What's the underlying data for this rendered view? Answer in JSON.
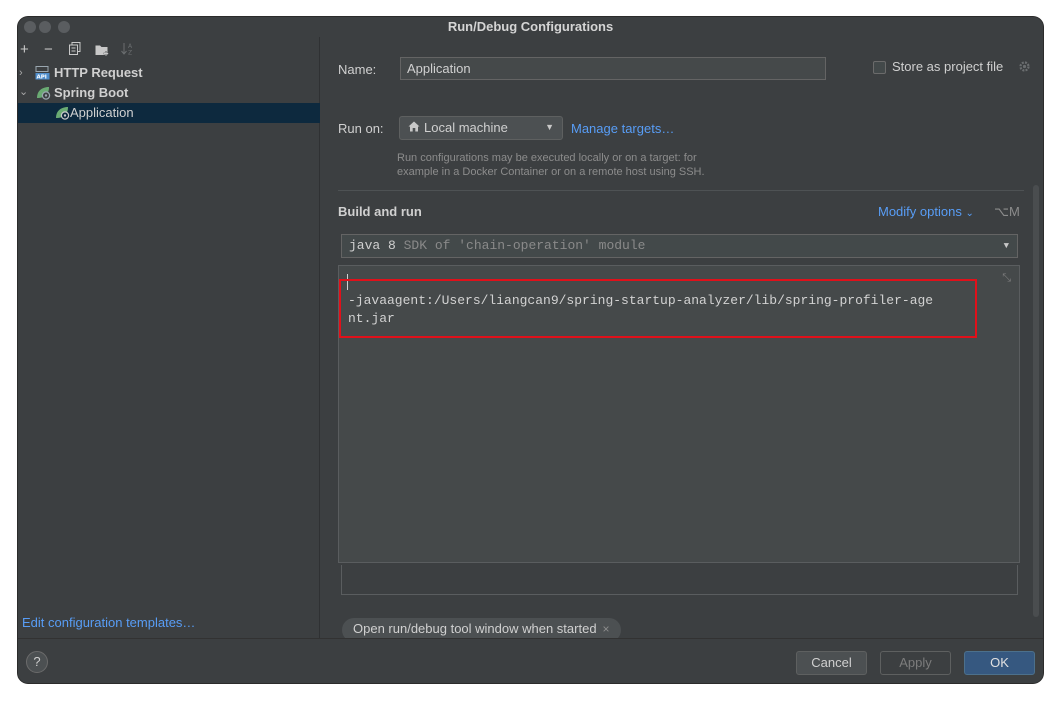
{
  "window": {
    "title": "Run/Debug Configurations"
  },
  "toolbar": {
    "add_icon": "+",
    "remove_icon": "−",
    "copy_icon": "copy-icon",
    "folder_icon": "folder-add-icon",
    "sort_icon": "sort-icon"
  },
  "tree": {
    "items": [
      {
        "label": "HTTP Request",
        "icon": "api-icon",
        "expanded": false
      },
      {
        "label": "Spring Boot",
        "icon": "spring-boot-icon",
        "expanded": true
      },
      {
        "label": "Application",
        "icon": "spring-boot-app-icon",
        "selected": true
      }
    ]
  },
  "left_footer": {
    "edit_templates": "Edit configuration templates…"
  },
  "config": {
    "name_label": "Name:",
    "name_value": "Application",
    "store_as_project_file": "Store as project file",
    "run_on_label": "Run on:",
    "run_on_value": "Local machine",
    "manage_targets": "Manage targets…",
    "help_line1": "Run configurations may be executed locally or on a target: for",
    "help_line2": "example in a Docker Container or on a remote host using SSH.",
    "build_and_run": "Build and run",
    "modify_options": "Modify options",
    "modify_shortcut": "⌥M",
    "jdk_version": "java 8",
    "jdk_hint": "SDK of 'chain-operation' module",
    "vm_options_line1": "-javaagent:/Users/liangcan9/spring-startup-analyzer/lib/spring-profiler-age",
    "vm_options_line2": "nt.jar",
    "chip_label": "Open run/debug tool window when started"
  },
  "buttons": {
    "help": "?",
    "cancel": "Cancel",
    "apply": "Apply",
    "ok": "OK"
  },
  "colors": {
    "background": "#3c3f41",
    "accent_link": "#589df6",
    "selection": "#0d293e",
    "highlight_border": "#e0101a",
    "ok_button": "#365880"
  }
}
